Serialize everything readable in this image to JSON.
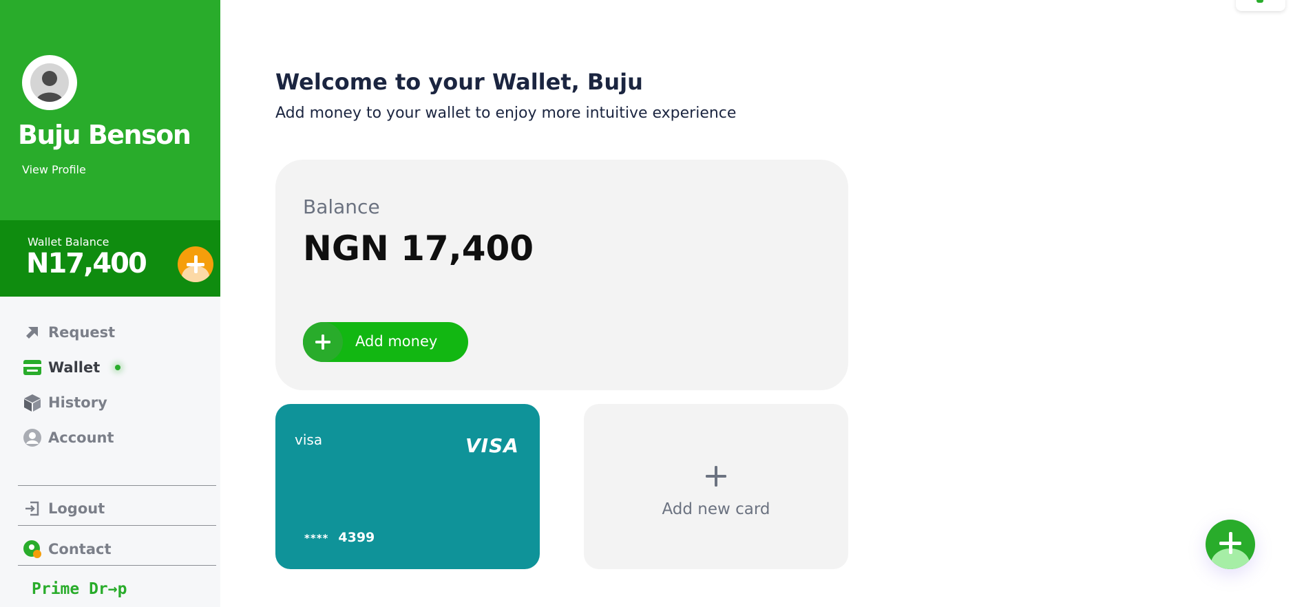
{
  "sidebar": {
    "user_name": "Buju Benson",
    "view_profile": "View Profile",
    "wallet": {
      "label": "Wallet Balance",
      "amount": "N17,400"
    },
    "nav": [
      {
        "label": "Request",
        "icon": "arrow-up-right-icon",
        "active": false
      },
      {
        "label": "Wallet",
        "icon": "wallet-icon",
        "active": true
      },
      {
        "label": "History",
        "icon": "box-icon",
        "active": false
      },
      {
        "label": "Account",
        "icon": "user-circle-icon",
        "active": false
      }
    ],
    "logout": "Logout",
    "contact": "Contact",
    "brand": "Prime Dr→p"
  },
  "main": {
    "title": "Welcome to your Wallet, Buju",
    "subtitle": "Add money to your wallet to enjoy more intuitive experience",
    "balance": {
      "label": "Balance",
      "value": "NGN 17,400",
      "add_money": "Add money"
    },
    "cards": [
      {
        "name": "visa",
        "brand": "VISA",
        "mask": "****",
        "last4": "4399"
      }
    ],
    "add_card_label": "Add new card"
  },
  "colors": {
    "primary_green": "#29ac2b",
    "dark_green": "#0f8c0f",
    "button_green": "#12b712",
    "accent_orange": "#f59e0b",
    "card_teal": "#0f9399",
    "heading": "#1b2540"
  }
}
